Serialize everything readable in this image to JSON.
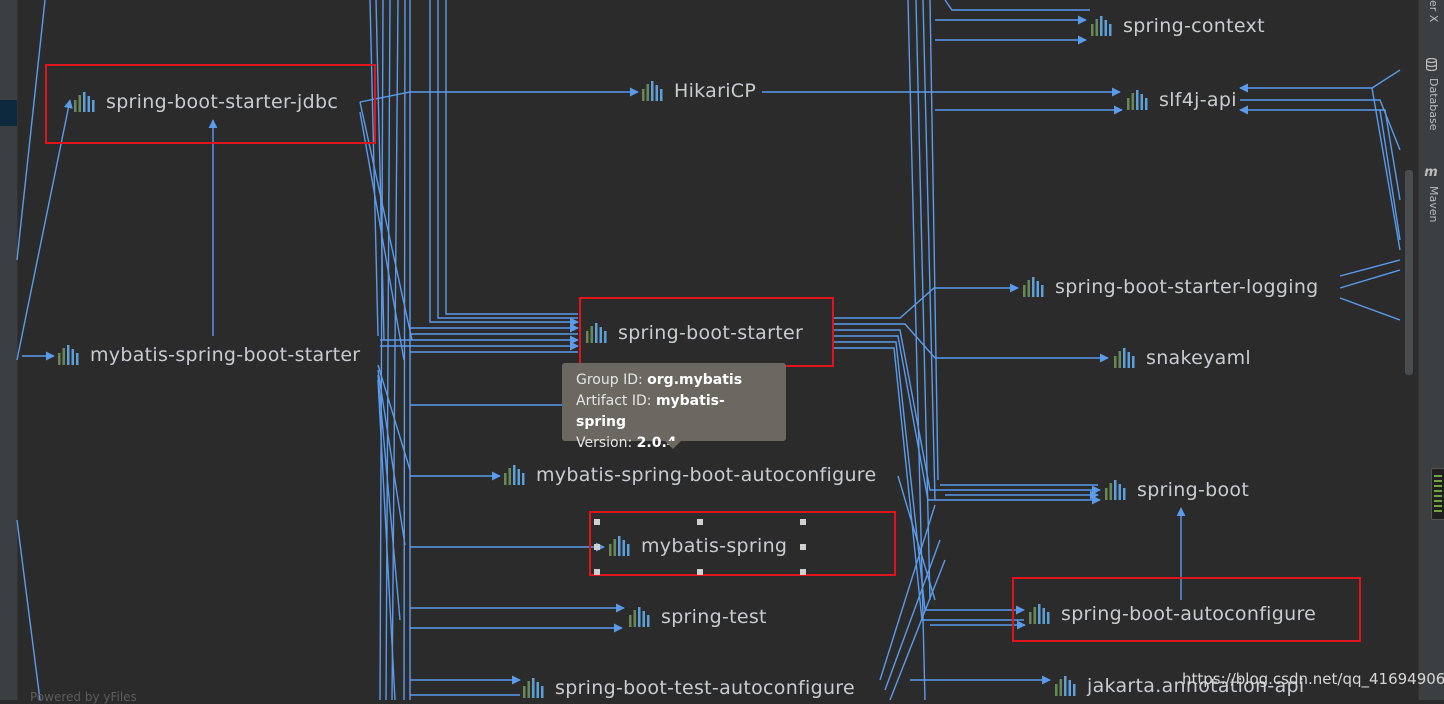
{
  "nodes": {
    "spring_boot_starter_jdbc": "spring-boot-starter-jdbc",
    "hikaricp": "HikariCP",
    "spring_context": "spring-context",
    "slf4j_api": "slf4j-api",
    "mybatis_spring_boot_starter": "mybatis-spring-boot-starter",
    "spring_boot_starter": "spring-boot-starter",
    "spring_boot_starter_logging": "spring-boot-starter-logging",
    "snakeyaml": "snakeyaml",
    "mybatis_spring_boot_autoconfigure": "mybatis-spring-boot-autoconfigure",
    "spring_boot": "spring-boot",
    "mybatis_spring": "mybatis-spring",
    "spring_boot_autoconfigure": "spring-boot-autoconfigure",
    "spring_test": "spring-test",
    "spring_boot_test_autoconfigure": "spring-boot-test-autoconfigure",
    "jakarta_annotation_api": "jakarta.annotation-api"
  },
  "tooltip": {
    "group_label": "Group ID:",
    "group_value": "org.mybatis",
    "artifact_label": "Artifact ID:",
    "artifact_value": "mybatis-spring",
    "version_label": "Version:",
    "version_value": "2.0.4"
  },
  "side_panel": {
    "top_label": "er X",
    "database_label": "Database",
    "maven_icon": "m",
    "maven_label": "Maven"
  },
  "watermark": "https://blog.csdn.net/qq_41694906",
  "footer": "Powered by yFiles",
  "icons": {
    "node": "library-bars-icon",
    "database": "database-icon",
    "maven": "maven-icon"
  },
  "colors": {
    "edge": "#5b9bec",
    "highlight": "#e0141d",
    "background": "#2b2b2b"
  }
}
